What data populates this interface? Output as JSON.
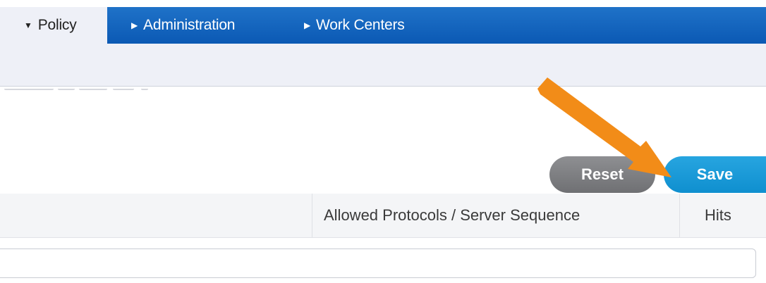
{
  "nav": {
    "tabs": [
      {
        "label": "Policy",
        "active": true
      },
      {
        "label": "Administration",
        "active": false
      },
      {
        "label": "Work Centers",
        "active": false
      }
    ]
  },
  "actions": {
    "reset_label": "Reset",
    "save_label": "Save"
  },
  "table": {
    "columns": [
      {
        "label": "Allowed Protocols / Server Sequence"
      },
      {
        "label": "Hits"
      }
    ],
    "filter": {
      "value": "",
      "placeholder": ""
    }
  },
  "colors": {
    "nav_blue": "#0b59b4",
    "save_blue": "#1a9ad6",
    "reset_gray": "#7e7f82",
    "arrow_orange": "#f28c18"
  },
  "icons": {
    "active_tab": "caret-down-icon",
    "inactive_tab": "caret-right-icon",
    "annotation": "arrow-annotation-icon"
  }
}
